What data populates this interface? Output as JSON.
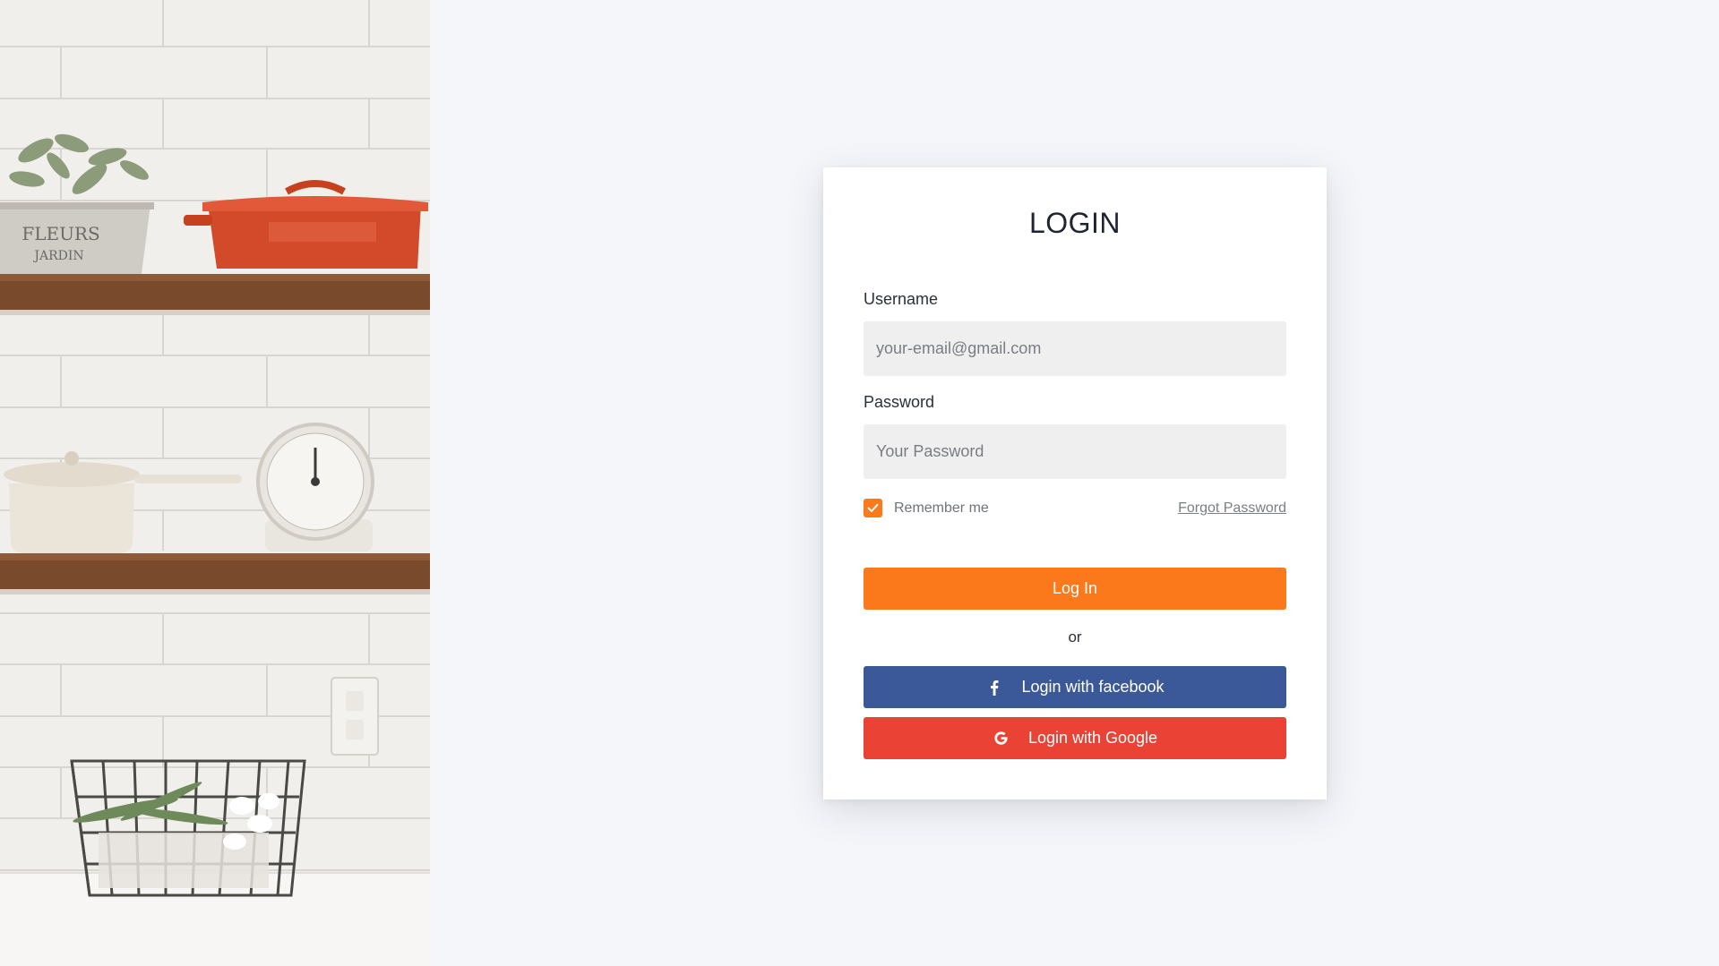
{
  "login": {
    "title": "LOGIN",
    "username_label": "Username",
    "username_placeholder": "your-email@gmail.com",
    "password_label": "Password",
    "password_placeholder": "Your Password",
    "remember_label": "Remember me",
    "remember_checked": true,
    "forgot_label": "Forgot Password",
    "login_button": "Log In",
    "separator": "or",
    "facebook_button": "Login with facebook",
    "google_button": "Login with Google"
  },
  "colors": {
    "background": "#f5f6fa",
    "accent": "#fb781b",
    "facebook": "#3b5998",
    "google": "#ea4335",
    "input_background": "#efefef"
  },
  "icons": {
    "checkbox": "check-icon",
    "facebook": "facebook-icon",
    "google": "google-icon"
  },
  "photo": {
    "planter_text": "FLEURS & JARDIN"
  }
}
